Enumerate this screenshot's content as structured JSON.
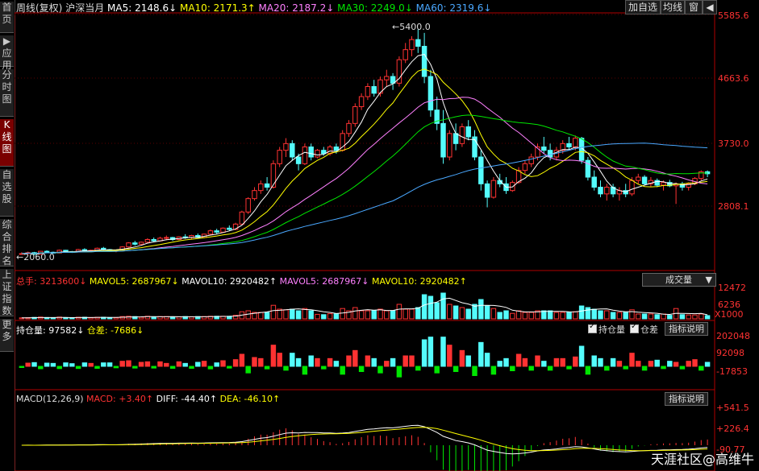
{
  "sidebar": [
    {
      "label": "首页",
      "active": false
    },
    {
      "label": "▶应用",
      "active": false
    },
    {
      "label": "分时图",
      "active": false
    },
    {
      "label": "K线图",
      "active": true
    },
    {
      "label": "自选股",
      "active": false
    },
    {
      "label": "综合排名",
      "active": false
    },
    {
      "label": "上证指数",
      "active": false
    },
    {
      "label": "更多",
      "active": false
    }
  ],
  "header": {
    "title": "周线(复权)",
    "symbol": "沪深当月",
    "ma5": "MA5: 2148.6↓",
    "ma10": "MA10: 2171.3↑",
    "ma20": "MA20: 2187.2↓",
    "ma30": "MA30: 2249.0↓",
    "ma60": "MA60: 2319.6↓"
  },
  "toolbar": {
    "add": "加自选",
    "avg": "均线",
    "win": "窗",
    "nav": "◀"
  },
  "price_axis": [
    "5585.6",
    "4663.6",
    "3730.0",
    "2808.1"
  ],
  "annotations": {
    "high": "5400.0",
    "low": "2060.0"
  },
  "volume_panel": {
    "total": "总手: 3213600↓",
    "mavol5": "MAVOL5: 2687967↓",
    "mavol10": "MAVOL10: 2920482↑",
    "mavol5b": "MAVOL5: 2687967↓",
    "mavol10b": "MAVOL10: 2920482↑",
    "selector": "成交量",
    "axis": [
      "12472",
      "6236",
      "X1000"
    ]
  },
  "oi_panel": {
    "oi": "持仓量: 97582↓",
    "diff": "仓差: -7686↓",
    "chk_oi": "持仓量",
    "chk_diff": "仓差",
    "help": "指标说明",
    "axis": [
      "202048",
      "92098",
      "-17853"
    ]
  },
  "macd_panel": {
    "name": "MACD(12,26,9)",
    "macd": "MACD: +3.40↑",
    "diff": "DIFF: -44.40↑",
    "dea": "DEA: -46.10↑",
    "help": "指标说明",
    "axis": [
      "+541.5",
      "+226.4",
      "-90.77"
    ]
  },
  "watermark": "天涯社区@高维牛",
  "colors": {
    "up": "#ff3232",
    "down": "#54fcfc",
    "ma5": "#ffffff",
    "ma10": "#ffff00",
    "ma20": "#ff80ff",
    "ma30": "#00e600",
    "ma60": "#4aa8ff",
    "axis": "#b00000"
  },
  "chart_data": {
    "type": "candlestick",
    "note_units": "index points",
    "candles": [
      [
        2060,
        2080,
        2050,
        2060
      ],
      [
        2060,
        2090,
        2055,
        2075
      ],
      [
        2075,
        2085,
        2040,
        2050
      ],
      [
        2050,
        2100,
        2045,
        2095
      ],
      [
        2095,
        2110,
        2070,
        2080
      ],
      [
        2080,
        2090,
        2060,
        2070
      ],
      [
        2070,
        2120,
        2065,
        2110
      ],
      [
        2110,
        2115,
        2080,
        2090
      ],
      [
        2090,
        2100,
        2070,
        2085
      ],
      [
        2085,
        2130,
        2080,
        2120
      ],
      [
        2120,
        2140,
        2090,
        2100
      ],
      [
        2100,
        2120,
        2080,
        2110
      ],
      [
        2110,
        2150,
        2100,
        2140
      ],
      [
        2140,
        2160,
        2110,
        2120
      ],
      [
        2120,
        2130,
        2090,
        2100
      ],
      [
        2100,
        2120,
        2080,
        2110
      ],
      [
        2110,
        2170,
        2100,
        2160
      ],
      [
        2160,
        2230,
        2150,
        2220
      ],
      [
        2220,
        2250,
        2180,
        2200
      ],
      [
        2200,
        2240,
        2190,
        2230
      ],
      [
        2230,
        2290,
        2210,
        2270
      ],
      [
        2270,
        2300,
        2240,
        2250
      ],
      [
        2250,
        2310,
        2240,
        2290
      ],
      [
        2290,
        2330,
        2260,
        2300
      ],
      [
        2300,
        2310,
        2250,
        2270
      ],
      [
        2270,
        2320,
        2260,
        2310
      ],
      [
        2310,
        2350,
        2280,
        2300
      ],
      [
        2300,
        2340,
        2280,
        2330
      ],
      [
        2330,
        2360,
        2290,
        2300
      ],
      [
        2300,
        2360,
        2290,
        2350
      ],
      [
        2350,
        2420,
        2340,
        2400
      ],
      [
        2400,
        2430,
        2350,
        2380
      ],
      [
        2380,
        2450,
        2370,
        2440
      ],
      [
        2440,
        2480,
        2400,
        2420
      ],
      [
        2420,
        2520,
        2410,
        2500
      ],
      [
        2500,
        2700,
        2480,
        2680
      ],
      [
        2680,
        2900,
        2650,
        2880
      ],
      [
        2880,
        3050,
        2850,
        3000
      ],
      [
        3000,
        3150,
        2950,
        3100
      ],
      [
        3100,
        3200,
        3000,
        3050
      ],
      [
        3050,
        3450,
        3030,
        3400
      ],
      [
        3400,
        3650,
        3350,
        3600
      ],
      [
        3600,
        3780,
        3500,
        3700
      ],
      [
        3700,
        3750,
        3450,
        3500
      ],
      [
        3500,
        3550,
        3300,
        3400
      ],
      [
        3400,
        3700,
        3380,
        3650
      ],
      [
        3650,
        3700,
        3450,
        3500
      ],
      [
        3500,
        3620,
        3480,
        3600
      ],
      [
        3600,
        3650,
        3520,
        3550
      ],
      [
        3550,
        3680,
        3520,
        3650
      ],
      [
        3650,
        3700,
        3550,
        3600
      ],
      [
        3600,
        3900,
        3580,
        3850
      ],
      [
        3850,
        4050,
        3800,
        4000
      ],
      [
        4000,
        4300,
        3950,
        4250
      ],
      [
        4250,
        4450,
        4200,
        4400
      ],
      [
        4400,
        4600,
        4350,
        4550
      ],
      [
        4550,
        4650,
        4400,
        4450
      ],
      [
        4450,
        4700,
        4400,
        4650
      ],
      [
        4650,
        4800,
        4550,
        4700
      ],
      [
        4700,
        4750,
        4500,
        4600
      ],
      [
        4600,
        5000,
        4550,
        4950
      ],
      [
        4950,
        5200,
        4900,
        5100
      ],
      [
        5100,
        5300,
        5000,
        5250
      ],
      [
        5250,
        5400,
        5050,
        5150
      ],
      [
        5150,
        5350,
        4600,
        4700
      ],
      [
        4700,
        4800,
        4100,
        4200
      ],
      [
        4200,
        4400,
        3900,
        4000
      ],
      [
        4000,
        4200,
        3400,
        3500
      ],
      [
        3500,
        3900,
        3450,
        3850
      ],
      [
        3850,
        4000,
        3600,
        3700
      ],
      [
        3700,
        4000,
        3650,
        3950
      ],
      [
        3950,
        4050,
        3750,
        3800
      ],
      [
        3800,
        3900,
        3450,
        3500
      ],
      [
        3500,
        3600,
        3000,
        3100
      ],
      [
        3100,
        3150,
        2750,
        2900
      ],
      [
        2900,
        3200,
        2880,
        3150
      ],
      [
        3150,
        3250,
        3050,
        3100
      ],
      [
        3100,
        3200,
        2950,
        3000
      ],
      [
        3000,
        3150,
        2980,
        3120
      ],
      [
        3120,
        3350,
        3100,
        3300
      ],
      [
        3300,
        3450,
        3250,
        3400
      ],
      [
        3400,
        3550,
        3350,
        3500
      ],
      [
        3500,
        3700,
        3450,
        3650
      ],
      [
        3650,
        3800,
        3550,
        3600
      ],
      [
        3600,
        3700,
        3450,
        3500
      ],
      [
        3500,
        3650,
        3450,
        3600
      ],
      [
        3600,
        3750,
        3550,
        3700
      ],
      [
        3700,
        3800,
        3600,
        3650
      ],
      [
        3650,
        3820,
        3600,
        3780
      ],
      [
        3780,
        3800,
        3400,
        3450
      ],
      [
        3450,
        3500,
        3150,
        3200
      ],
      [
        3200,
        3300,
        3000,
        3050
      ],
      [
        3050,
        3150,
        2900,
        2950
      ],
      [
        2950,
        3100,
        2850,
        3050
      ],
      [
        3050,
        3100,
        2900,
        2950
      ],
      [
        2950,
        3050,
        2850,
        3000
      ],
      [
        3000,
        3100,
        2900,
        2950
      ],
      [
        2950,
        3200,
        2920,
        3150
      ],
      [
        3150,
        3250,
        3100,
        3200
      ],
      [
        3200,
        3230,
        3080,
        3100
      ],
      [
        3100,
        3200,
        3050,
        3150
      ],
      [
        3150,
        3180,
        3050,
        3080
      ],
      [
        3080,
        3150,
        3000,
        3120
      ],
      [
        3120,
        3160,
        3050,
        3070
      ],
      [
        3070,
        3120,
        2800,
        3100
      ],
      [
        3100,
        3130,
        3000,
        3050
      ],
      [
        3050,
        3120,
        3000,
        3100
      ],
      [
        3100,
        3200,
        3080,
        3180
      ],
      [
        3180,
        3300,
        3150,
        3280
      ],
      [
        3280,
        3300,
        3200,
        3250
      ]
    ],
    "ylim": [
      2000,
      5600
    ]
  }
}
